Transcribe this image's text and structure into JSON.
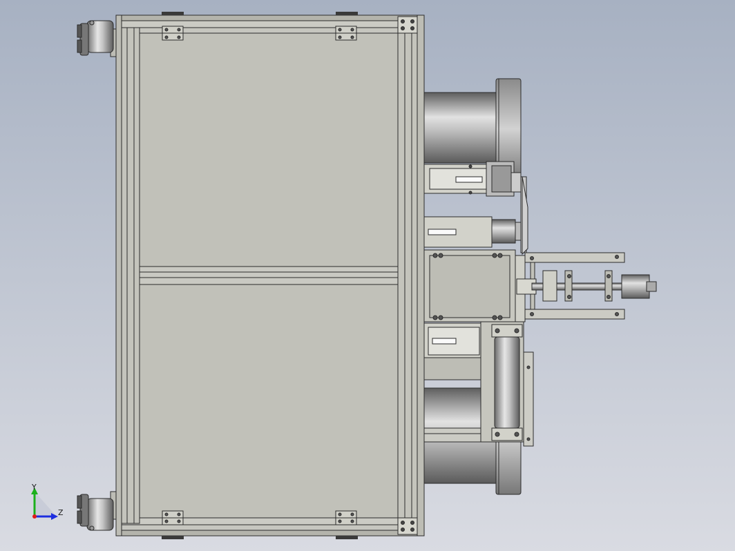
{
  "viewport": {
    "background_top": "#a7b1c2",
    "background_bottom": "#d9dbe2"
  },
  "colors": {
    "panel": "#c1c1b9",
    "frame": "#b4b4ac",
    "rail": "#cbcbc4",
    "edge": "#2b2b2b",
    "metal_dark": "#6e6e6e",
    "metal_light": "#d8d8d8",
    "axis_y": "#1bb01b",
    "axis_z": "#1d2ee0",
    "axis_origin": "#e01b1b"
  },
  "triad": {
    "y_label": "Y",
    "z_label": "Z"
  }
}
